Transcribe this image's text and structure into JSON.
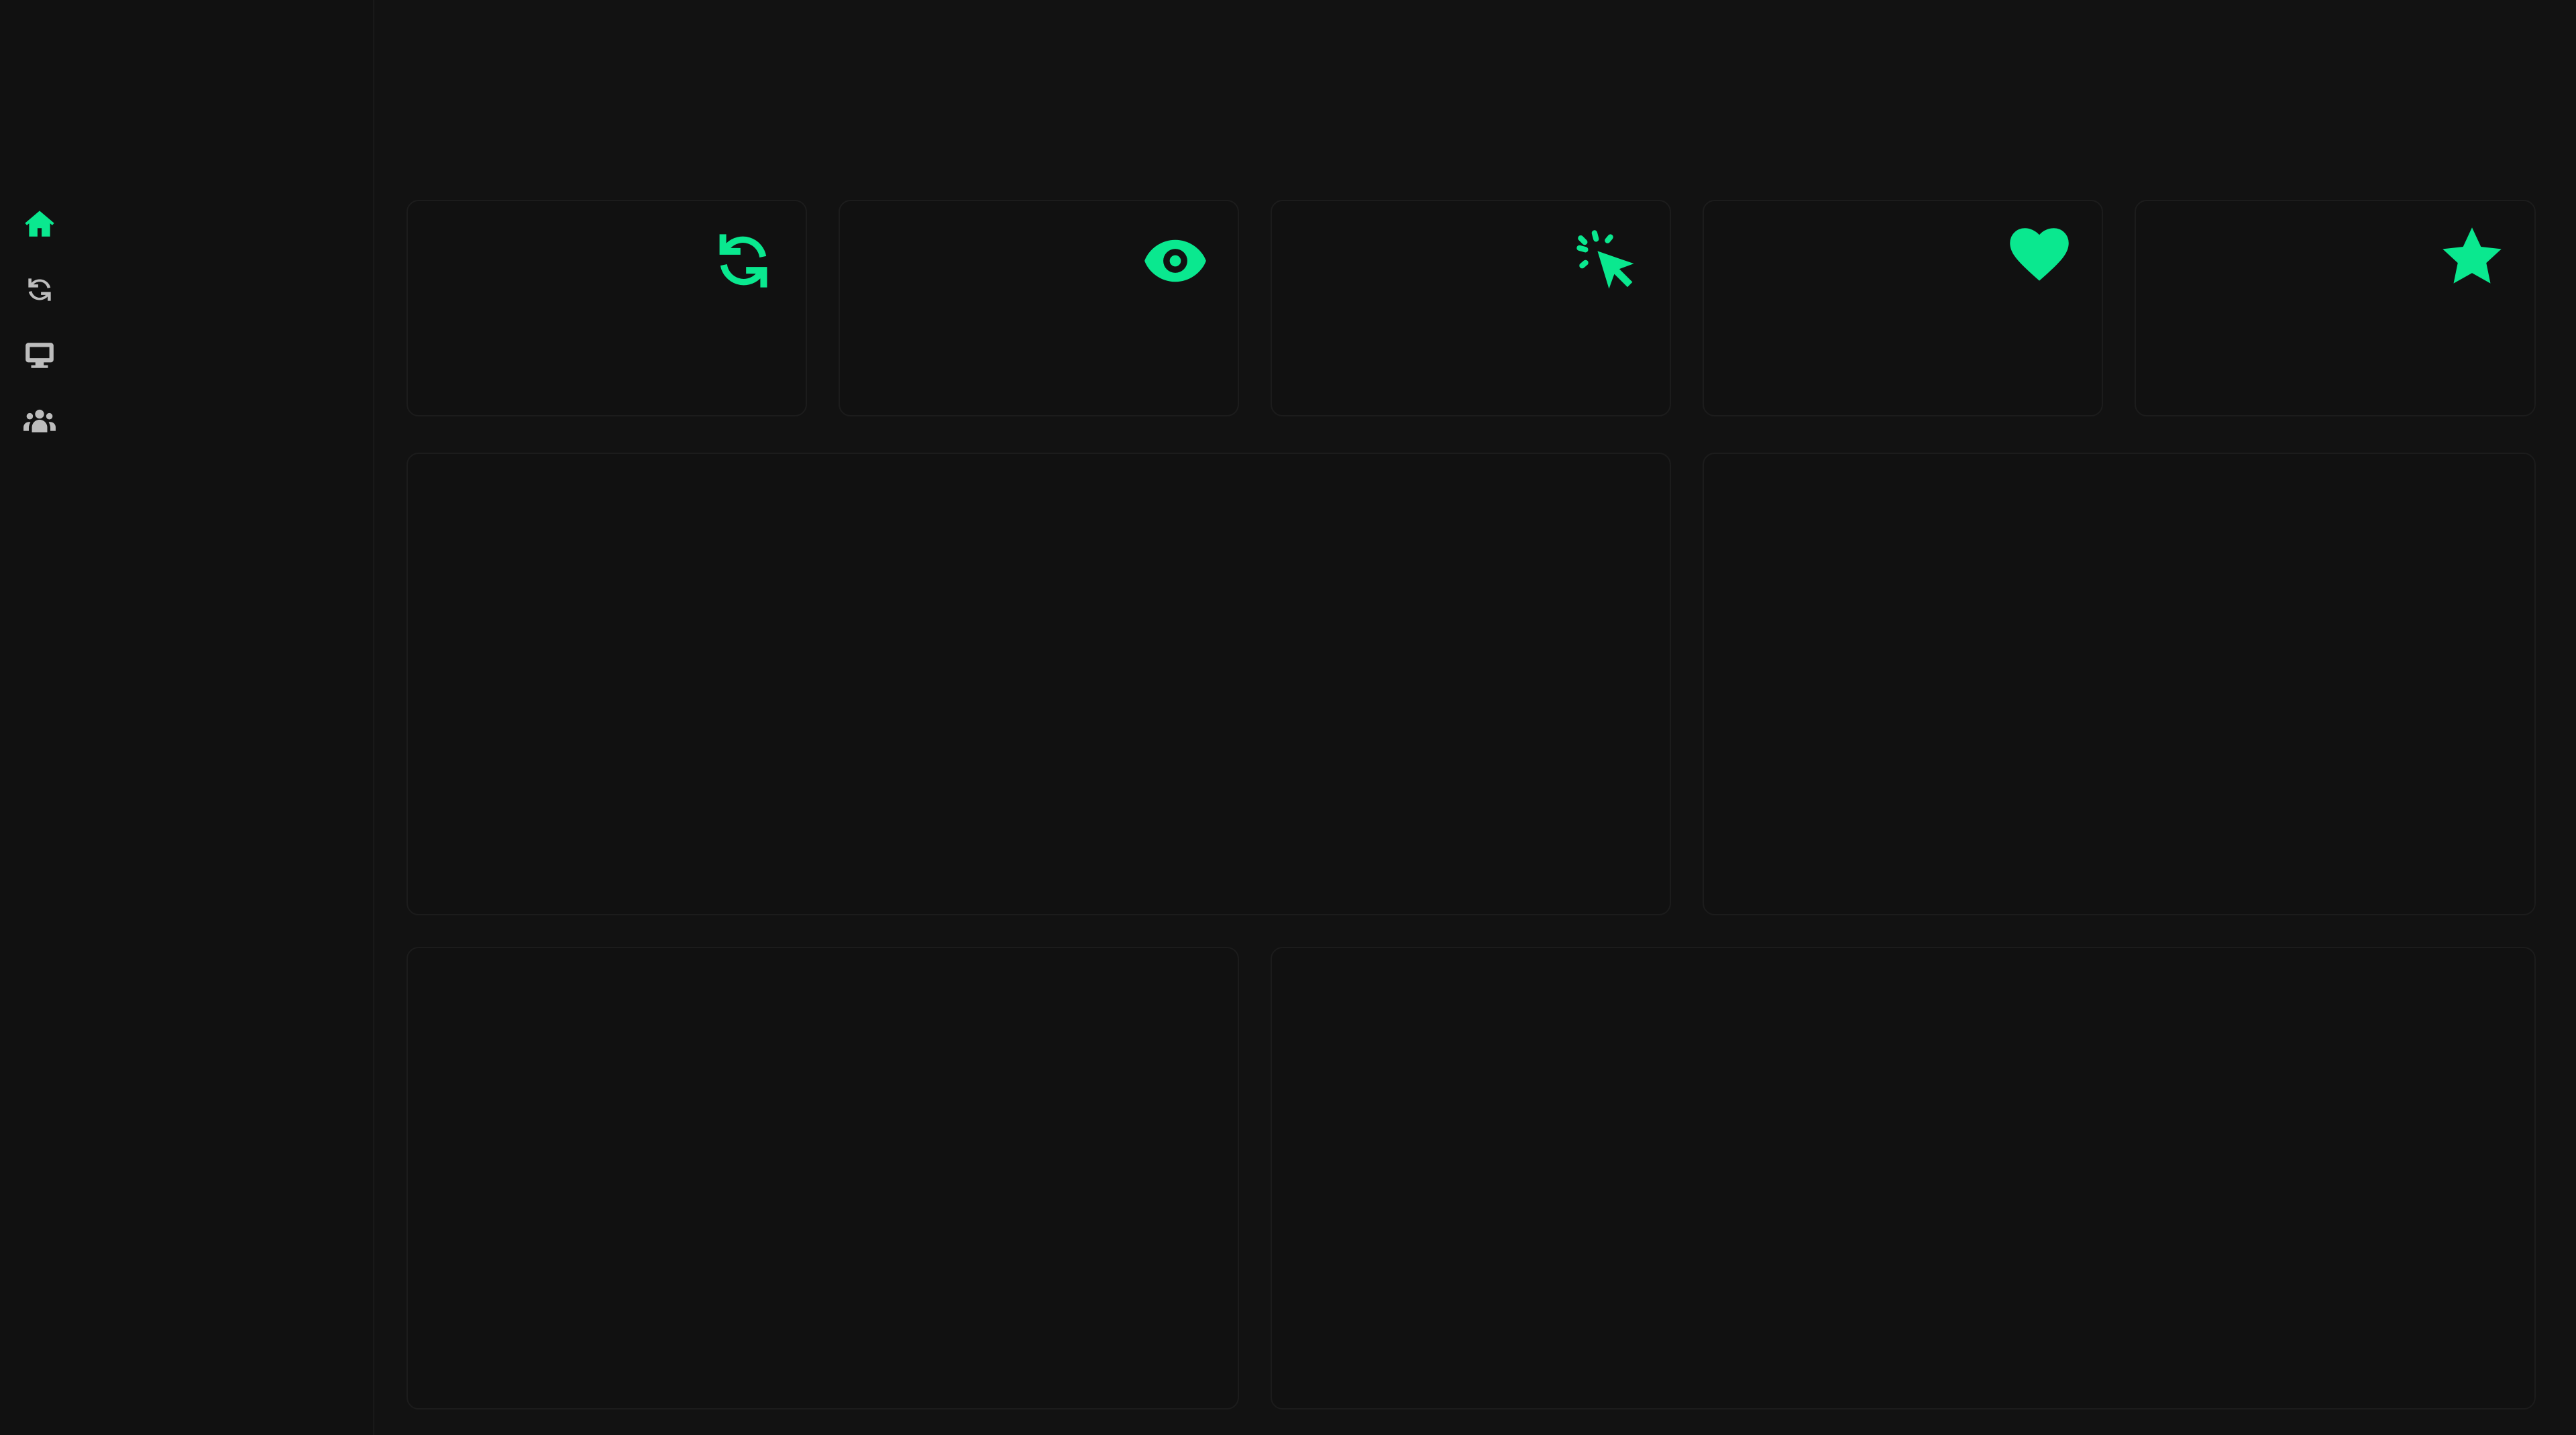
{
  "theme": {
    "accent": "#0ae88f",
    "background": "#121212",
    "sidebar_background": "#111111",
    "card_background": "#111111",
    "card_border": "#1c1c1c",
    "inactive_icon": "#bdbdbd"
  },
  "sidebar": {
    "items": [
      {
        "icon": "home-icon",
        "active": true
      },
      {
        "icon": "sync-icon",
        "active": false
      },
      {
        "icon": "monitor-icon",
        "active": false
      },
      {
        "icon": "users-icon",
        "active": false
      }
    ]
  },
  "stat_cards": [
    {
      "icon": "sync-icon"
    },
    {
      "icon": "eye-icon"
    },
    {
      "icon": "pointer-click-icon"
    },
    {
      "icon": "heart-icon"
    },
    {
      "icon": "star-icon"
    }
  ],
  "panels": [
    {
      "name": "panel-large-left"
    },
    {
      "name": "panel-right"
    },
    {
      "name": "panel-bottom-left"
    },
    {
      "name": "panel-bottom-right"
    }
  ]
}
